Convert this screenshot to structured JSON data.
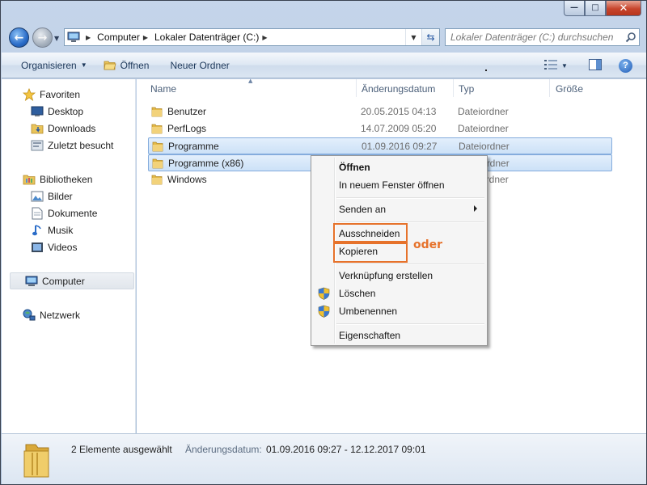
{
  "window": {
    "caption_icons": [
      "minimize-icon",
      "maximize-icon",
      "close-icon"
    ]
  },
  "address": {
    "crumbs": [
      "Computer",
      "Lokaler Datenträger (C:)"
    ]
  },
  "search": {
    "placeholder": "Lokaler Datenträger (C:) durchsuchen"
  },
  "toolbar": {
    "organize": "Organisieren",
    "open": "Öffnen",
    "new_folder": "Neuer Ordner"
  },
  "sidebar": {
    "favorites": {
      "label": "Favoriten",
      "items": [
        "Desktop",
        "Downloads",
        "Zuletzt besucht"
      ]
    },
    "libraries": {
      "label": "Bibliotheken",
      "items": [
        "Bilder",
        "Dokumente",
        "Musik",
        "Videos"
      ]
    },
    "computer": "Computer",
    "network": "Netzwerk"
  },
  "columns": {
    "name": "Name",
    "date": "Änderungsdatum",
    "type": "Typ",
    "size": "Größe"
  },
  "files": [
    {
      "name": "Benutzer",
      "date": "20.05.2015 04:13",
      "type": "Dateiordner",
      "selected": false
    },
    {
      "name": "PerfLogs",
      "date": "14.07.2009 05:20",
      "type": "Dateiordner",
      "selected": false
    },
    {
      "name": "Programme",
      "date": "01.09.2016 09:27",
      "type": "Dateiordner",
      "selected": true
    },
    {
      "name": "Programme (x86)",
      "date": "",
      "type": "Dateiordner",
      "selected": true
    },
    {
      "name": "Windows",
      "date": "",
      "type": "Dateiordner",
      "selected": false
    }
  ],
  "context_menu": {
    "open": "Öffnen",
    "open_new_window": "In neuem Fenster öffnen",
    "send_to": "Senden an",
    "cut": "Ausschneiden",
    "copy": "Kopieren",
    "create_shortcut": "Verknüpfung erstellen",
    "delete": "Löschen",
    "rename": "Umbenennen",
    "properties": "Eigenschaften"
  },
  "annotation": {
    "or_label": "oder",
    "highlight_color": "#e6722b"
  },
  "status": {
    "selected": "2 Elemente ausgewählt",
    "date_label": "Änderungsdatum:",
    "date_value": "01.09.2016 09:27 - 12.12.2017 09:01"
  },
  "colors": {
    "selection": "#cce1f7",
    "accent": "#1e395b"
  }
}
